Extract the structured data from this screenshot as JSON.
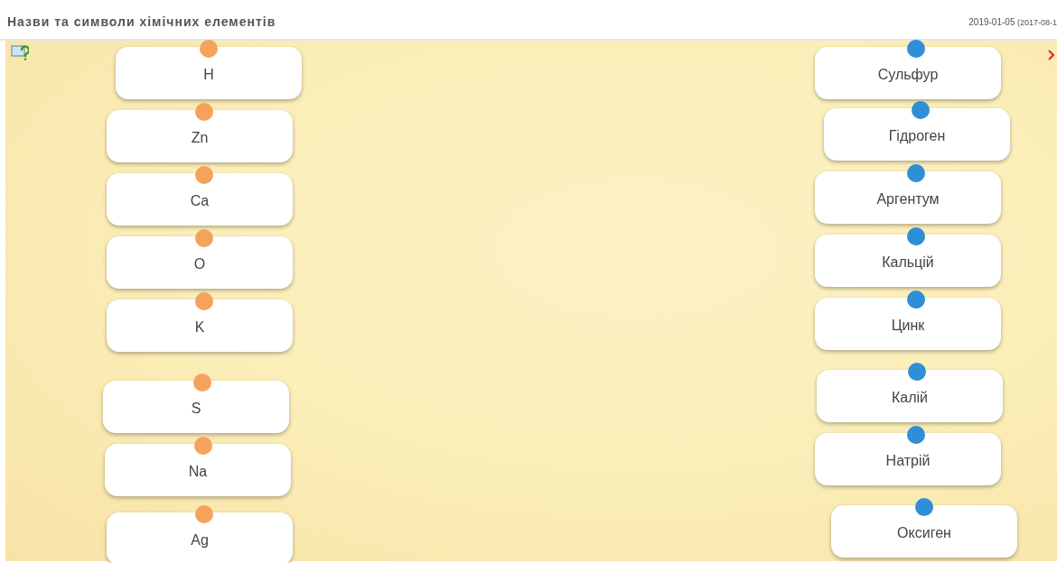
{
  "header": {
    "title": "Назви та символи хімічних елементів",
    "date": "2019-01-05",
    "date_note": "(2017-08-1"
  },
  "columns": [
    {
      "kind": "symbols",
      "color": "#f5a35c",
      "cards": [
        "H",
        "Zn",
        "Ca",
        "O",
        "K",
        "S",
        "Na",
        "Ag"
      ]
    },
    {
      "kind": "names",
      "color": "#2e8fd6",
      "cards": [
        "Сульфур",
        "Гідроген",
        "Аргентум",
        "Кальцій",
        "Цинк",
        "Калій",
        "Натрій",
        "Оксиген"
      ]
    }
  ]
}
